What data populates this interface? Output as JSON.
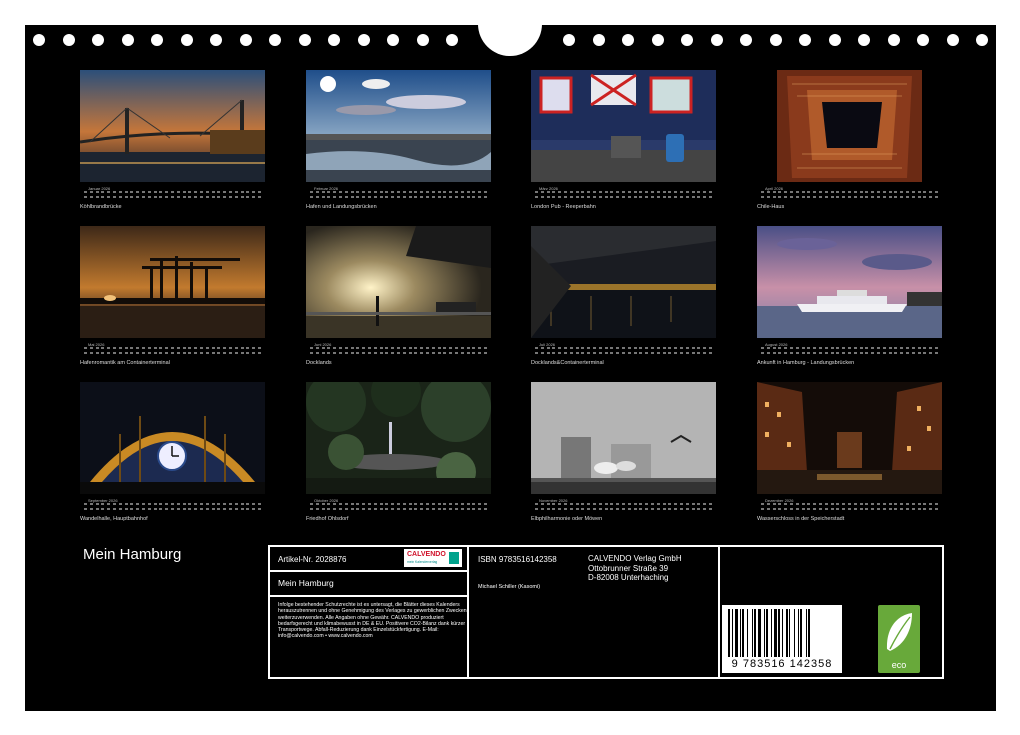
{
  "calendar_title": "Mein Hamburg",
  "months": [
    {
      "label": "Januar 2026",
      "caption": "Köhlbrandbrücke",
      "photo": "bridge-dusk"
    },
    {
      "label": "Februar 2026",
      "caption": "Hafen und Landungsbrücken",
      "photo": "harbor-sky"
    },
    {
      "label": "März 2026",
      "caption": "London Pub - Reeperbahn",
      "photo": "pub"
    },
    {
      "label": "April 2026",
      "caption": "Chile-Haus",
      "photo": "courtyard"
    },
    {
      "label": "Mai 2026",
      "caption": "Hafenromantik am Containerterminal",
      "photo": "cranes-sunset"
    },
    {
      "label": "Juni 2026",
      "caption": "Docklands",
      "photo": "docklands"
    },
    {
      "label": "Juli 2026",
      "caption": "Docklands&Containerterminal",
      "photo": "night-river"
    },
    {
      "label": "August 2026",
      "caption": "Ankunft in Hamburg - Landungsbrücken",
      "photo": "cruise-ship"
    },
    {
      "label": "September 2026",
      "caption": "Wandelhalle, Hauptbahnhof",
      "photo": "station-clock"
    },
    {
      "label": "Oktober 2026",
      "caption": "Friedhof Ohlsdorf",
      "photo": "garden-fountain"
    },
    {
      "label": "November 2026",
      "caption": "Elbphilharmonie oder Möwen",
      "photo": "gulls"
    },
    {
      "label": "Dezember 2026",
      "caption": "Wasserschloss in der Speicherstadt",
      "photo": "speicherstadt"
    }
  ],
  "info": {
    "article": "Artikel-Nr. 2028876",
    "title": "Mein Hamburg",
    "legal": "Infolge bestehender Schutzrechte ist es untersagt, die Blätter dieses Kalenders herauszutrennen und ohne Genehmigung des Verlages zu gewerblichen Zwecken weiterzuverwenden. Alle Angaben ohne Gewähr. CALVENDO produziert bedarfsgerecht und klimabewusst in DE & EU. Positivere CO2-Bilanz dank kürzer Transportwege. Abfall-Reduzierung dank Einzelstückfertigung. E-Mail: info@calvendo.com • www.calvendo.com",
    "isbn": "ISBN 9783516142358",
    "author": "Michael Schiller (Kasomi)",
    "publisher_name": "CALVENDO Verlag GmbH",
    "publisher_street": "Ottobrunner Straße 39",
    "publisher_city": "D-82008 Unterhaching",
    "barcode_number": "9 783516 142358",
    "logo_word": "CALVENDO",
    "logo_sub": "mein Kalenderverlag",
    "eco_label": "eco"
  },
  "icons": {
    "calvendo": "calvendo-logo-icon",
    "eco": "eco-leaf-icon",
    "barcode": "barcode-icon"
  },
  "colors": {
    "background": "#000000",
    "eco_green": "#68a93a",
    "calvendo_red": "#d0102a",
    "calvendo_teal": "#00a28c"
  }
}
